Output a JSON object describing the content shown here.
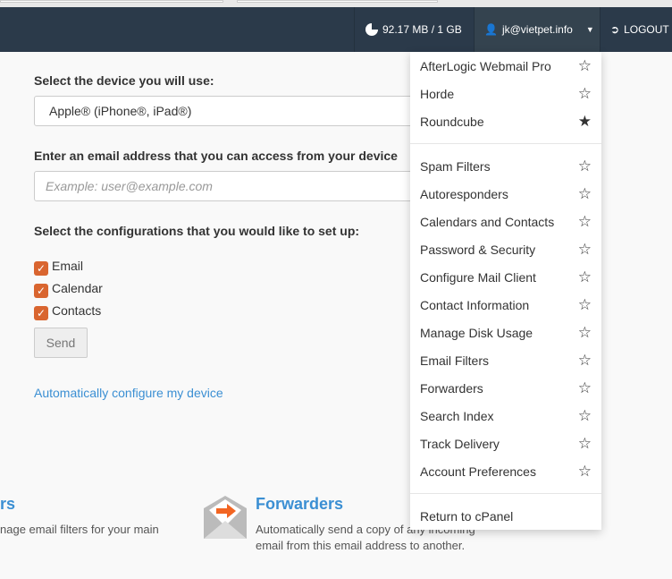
{
  "navbar": {
    "disk_usage": "92.17 MB / 1 GB",
    "user": "jk@vietpet.info",
    "logout": "LOGOUT"
  },
  "form": {
    "device_label": "Select the device you will use:",
    "device_value": "Apple® (iPhone®, iPad®)",
    "email_label": "Enter an email address that you can access from your device",
    "email_placeholder": "Example: user@example.com",
    "config_label": "Select the configurations that you would like to set up:",
    "options": [
      {
        "label": "Email",
        "checked": true
      },
      {
        "label": "Calendar",
        "checked": true
      },
      {
        "label": "Contacts",
        "checked": true
      }
    ],
    "send": "Send",
    "auto_link": "Automatically configure my device"
  },
  "tiles": [
    {
      "title": "rs",
      "desc": "nage email filters for your main"
    },
    {
      "title": "Forwarders",
      "desc1": "Automatically send a copy of any incoming",
      "desc2": "email from this email address to another."
    }
  ],
  "menu": {
    "webmail": [
      {
        "label": "AfterLogic Webmail Pro",
        "starred": false
      },
      {
        "label": "Horde",
        "starred": false
      },
      {
        "label": "Roundcube",
        "starred": true
      }
    ],
    "tools": [
      {
        "label": "Spam Filters"
      },
      {
        "label": "Autoresponders"
      },
      {
        "label": "Calendars and Contacts"
      },
      {
        "label": "Password & Security"
      },
      {
        "label": "Configure Mail Client"
      },
      {
        "label": "Contact Information"
      },
      {
        "label": "Manage Disk Usage"
      },
      {
        "label": "Email Filters"
      },
      {
        "label": "Forwarders"
      },
      {
        "label": "Search Index"
      },
      {
        "label": "Track Delivery"
      },
      {
        "label": "Account Preferences"
      }
    ],
    "return": "Return to cPanel"
  }
}
